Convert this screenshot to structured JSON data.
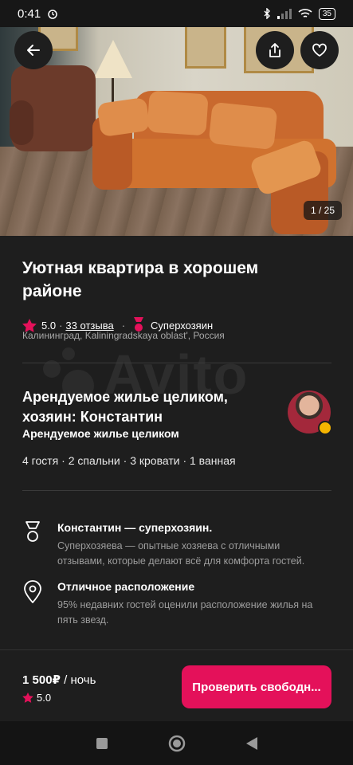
{
  "status_bar": {
    "time": "0:41",
    "battery": "35"
  },
  "gallery": {
    "counter": "1 / 25"
  },
  "listing": {
    "title": "Уютная квартира в хорошем районе",
    "rating": "5.0",
    "rating_sep": "·",
    "reviews": "33 отзыва",
    "superhost": "Суперхозяин",
    "location": "Калининград, Kaliningradskaya oblast', Россия"
  },
  "watermark": "Avito",
  "host": {
    "title": "Арендуемое жилье целиком, хозяин: Константин",
    "subtitle": "Арендуемое жилье целиком",
    "features": "4 гостя · 2 спальни · 3 кровати · 1 ванная"
  },
  "highlights": [
    {
      "title": "Константин — суперхозяин.",
      "description": "Суперхозяева — опытные хозяева с отличными отзывами, которые делают всё для комфорта гостей."
    },
    {
      "title": "Отличное расположение",
      "description": "95% недавних гостей оценили расположение жилья на пять звезд."
    }
  ],
  "booking": {
    "price": "1 500₽",
    "price_unit": " / ночь",
    "rating": "5.0",
    "cta_label": "Проверить свободн..."
  },
  "colors": {
    "accent": "#e4115a",
    "star": "#e4115a",
    "background": "#1e1e1e"
  },
  "icons": [
    "back-arrow-icon",
    "share-icon",
    "heart-icon",
    "star-icon",
    "superhost-medal-icon",
    "location-pin-icon",
    "nav-recents-icon",
    "nav-home-icon",
    "nav-back-icon"
  ]
}
